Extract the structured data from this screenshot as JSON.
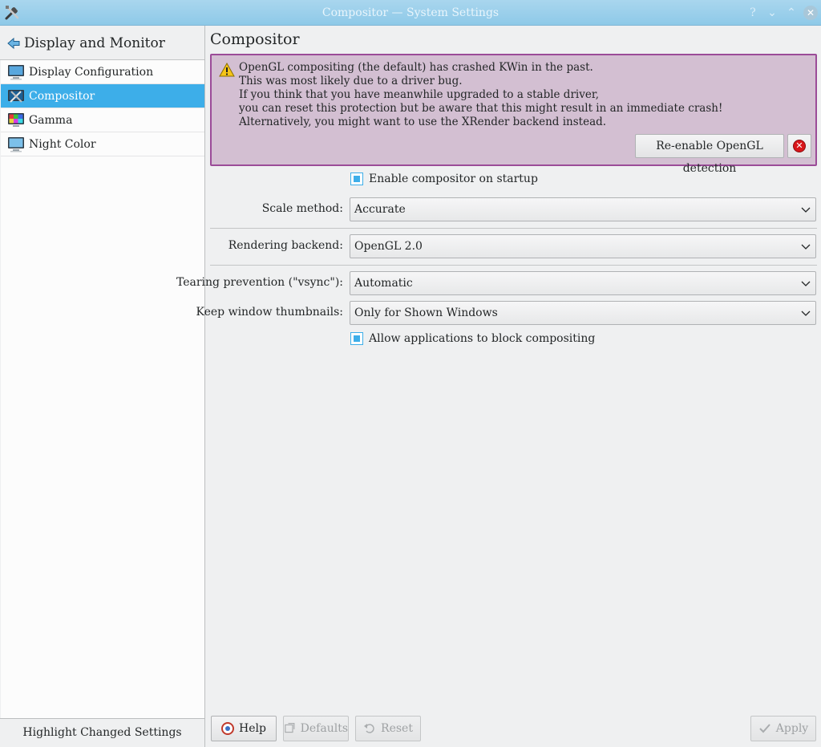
{
  "window": {
    "title": "Compositor — System Settings",
    "help_glyph": "?",
    "minimize_glyph": "⌄",
    "maximize_glyph": "⌃",
    "close_glyph": "✕"
  },
  "sidebar": {
    "header_title": "Display and Monitor",
    "items": [
      {
        "label": "Display Configuration",
        "icon": "monitor-icon"
      },
      {
        "label": "Compositor",
        "icon": "compositor-icon",
        "selected": true
      },
      {
        "label": "Gamma",
        "icon": "gamma-icon"
      },
      {
        "label": "Night Color",
        "icon": "night-color-icon"
      }
    ],
    "footer_label": "Highlight Changed Settings"
  },
  "main": {
    "title": "Compositor",
    "warning": {
      "lines": [
        "OpenGL compositing (the default) has crashed KWin in the past.",
        "This was most likely due to a driver bug.",
        "If you think that you have meanwhile upgraded to a stable driver,",
        "you can reset this protection but be aware that this might result in an immediate crash!",
        "Alternatively, you might want to use the XRender backend instead."
      ],
      "reenable_label": "Re-enable OpenGL detection",
      "dismiss_glyph": "✕"
    },
    "enable_on_startup": {
      "label": "Enable compositor on startup",
      "checked": true
    },
    "scale_method": {
      "label": "Scale method:",
      "value": "Accurate"
    },
    "rendering_backend": {
      "label": "Rendering backend:",
      "value": "OpenGL 2.0"
    },
    "tearing_prevention": {
      "label": "Tearing prevention (\"vsync\"):",
      "value": "Automatic"
    },
    "keep_thumbnails": {
      "label": "Keep window thumbnails:",
      "value": "Only for Shown Windows"
    },
    "allow_block": {
      "label": "Allow applications to block compositing",
      "checked": true
    }
  },
  "footer": {
    "help_label": "Help",
    "defaults_label": "Defaults",
    "reset_label": "Reset",
    "apply_label": "Apply"
  },
  "colors": {
    "accent": "#3daee9",
    "warning_bg": "#d3bfd2",
    "warning_border": "#9b4c98"
  }
}
